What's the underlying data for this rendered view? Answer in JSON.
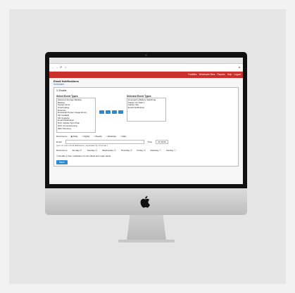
{
  "nav": {
    "links": [
      "Facilities",
      "Wholesale Sites",
      "Reports",
      "Help",
      "Logout"
    ]
  },
  "page": {
    "title": "Email Notifications",
    "link": "Scheduler",
    "enable_label": "Enable",
    "select_event_types": "Select Event Types",
    "selected_event_types": "Selected Event Types",
    "event_types": [
      "Selected Storage Backup",
      "Backup",
      "System Error",
      "Overheating",
      "Directory",
      "Download Power Usage Errors",
      "SD Installed",
      "SD Upgrade",
      "Email Notification",
      "NVC Vehicle Sync Plan",
      "NVC Commissioning",
      "NRC Directory"
    ],
    "selected_types": [
      "Emergency Battery Switching",
      "Failure On Path 1",
      "Failure Info",
      "Email Notification"
    ],
    "recurrence_label": "Recurrence",
    "recurrence_opts": [
      "Daily",
      "Nightly",
      "Weekly",
      "Weekday",
      "Daily"
    ],
    "email_label": "Email",
    "time_label": "Time",
    "time_value": "12:15:00",
    "email_hint": "(one or more email addresses, separated by commas.)",
    "days_label": "Recurrence",
    "days": [
      "Sunday",
      "Tuesday",
      "Wednesday",
      "Thursday",
      "Friday",
      "Saturday",
      "Sunday"
    ],
    "hourly_note": "Enable 1 hour notification for all critical and major alerts",
    "save_label": "Save"
  }
}
